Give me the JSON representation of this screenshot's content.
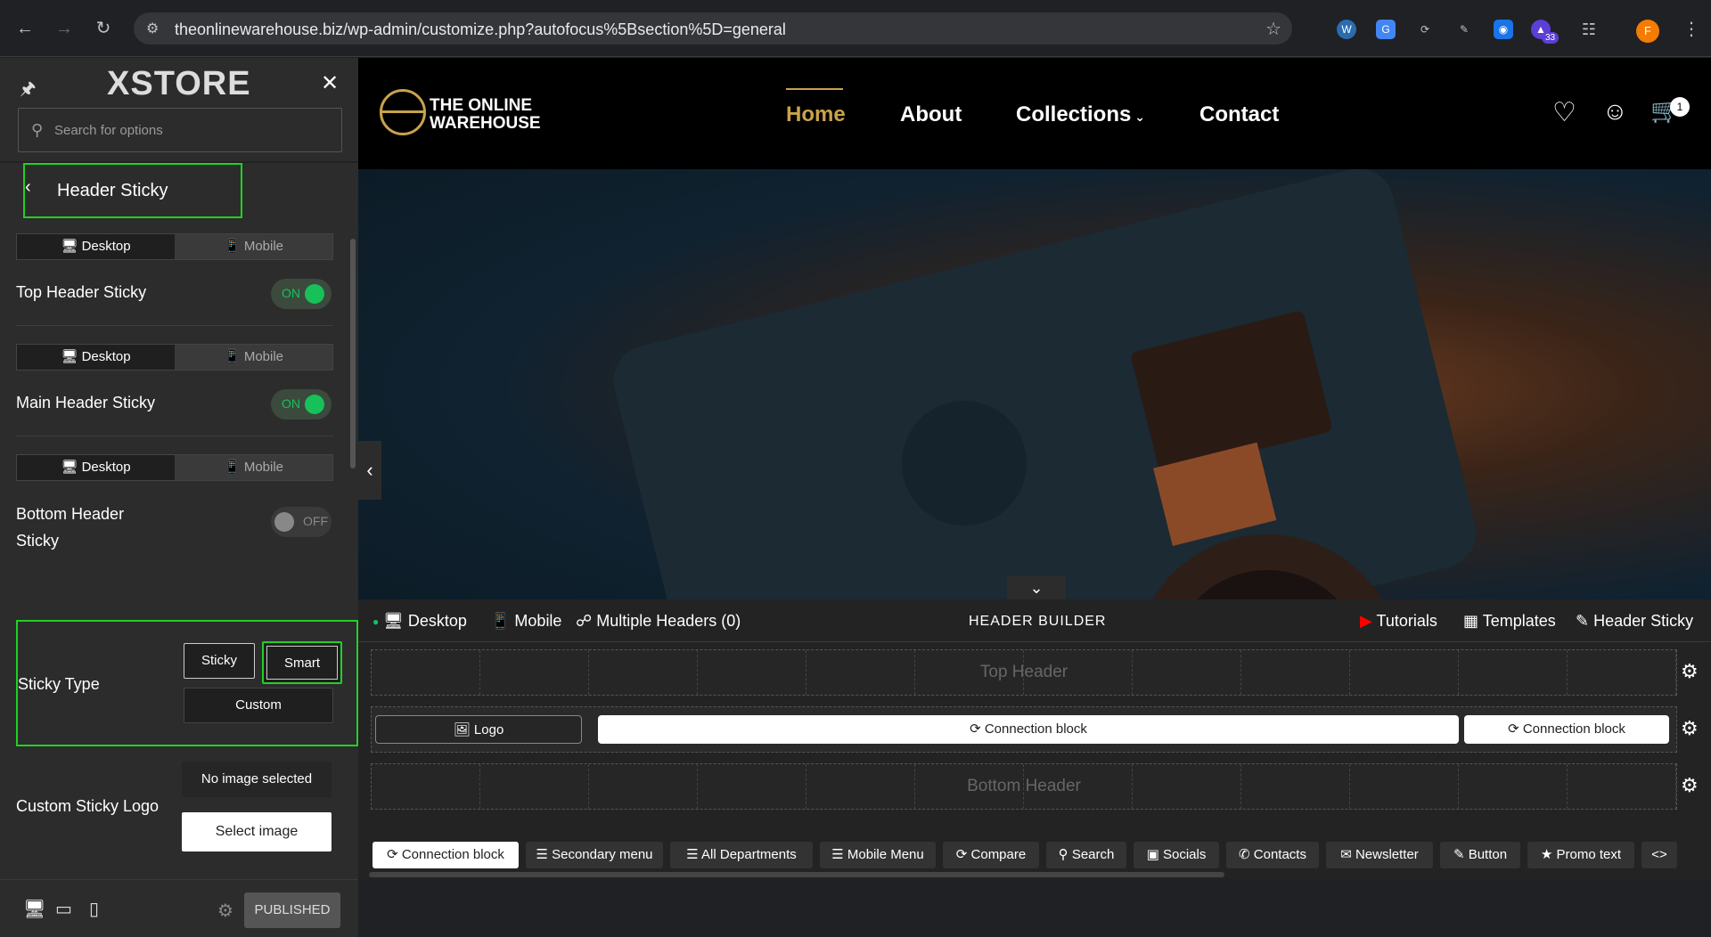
{
  "browser": {
    "url": "theonlinewarehouse.biz/wp-admin/customize.php?autofocus%5Bsection%5D=general",
    "ext_badge": "33",
    "avatar_letter": "F"
  },
  "sidebar": {
    "logo": "XSTORE",
    "search_placeholder": "Search for options",
    "section_title": "Header Sticky",
    "device_desktop": "Desktop",
    "device_mobile": "Mobile",
    "top_header_sticky": "Top Header Sticky",
    "main_header_sticky": "Main Header Sticky",
    "bottom_header_sticky": "Bottom Header Sticky",
    "toggle_on": "ON",
    "toggle_off": "OFF",
    "sticky_type": "Sticky Type",
    "sticky_btn": "Sticky",
    "smart_btn": "Smart",
    "custom_btn": "Custom",
    "custom_logo_label": "Custom Sticky Logo",
    "no_image": "No image selected",
    "select_image": "Select image",
    "published": "PUBLISHED"
  },
  "site": {
    "logo_line1": "THE ONLINE",
    "logo_line2": "WAREHOUSE",
    "menu": [
      "Home",
      "About",
      "Collections",
      "Contact"
    ],
    "cart_count": "1"
  },
  "builder": {
    "desktop": "Desktop",
    "mobile": "Mobile",
    "multiple_headers": "Multiple Headers (0)",
    "title": "HEADER BUILDER",
    "tutorials": "Tutorials",
    "templates": "Templates",
    "header_sticky": "Header Sticky",
    "top_header": "Top Header",
    "bottom_header": "Bottom Header",
    "logo_block": "Logo",
    "connection_block": "Connection block",
    "tray": [
      "Connection block",
      "Secondary menu",
      "All Departments",
      "Mobile Menu",
      "Compare",
      "Search",
      "Socials",
      "Contacts",
      "Newsletter",
      "Button",
      "Promo text"
    ]
  }
}
